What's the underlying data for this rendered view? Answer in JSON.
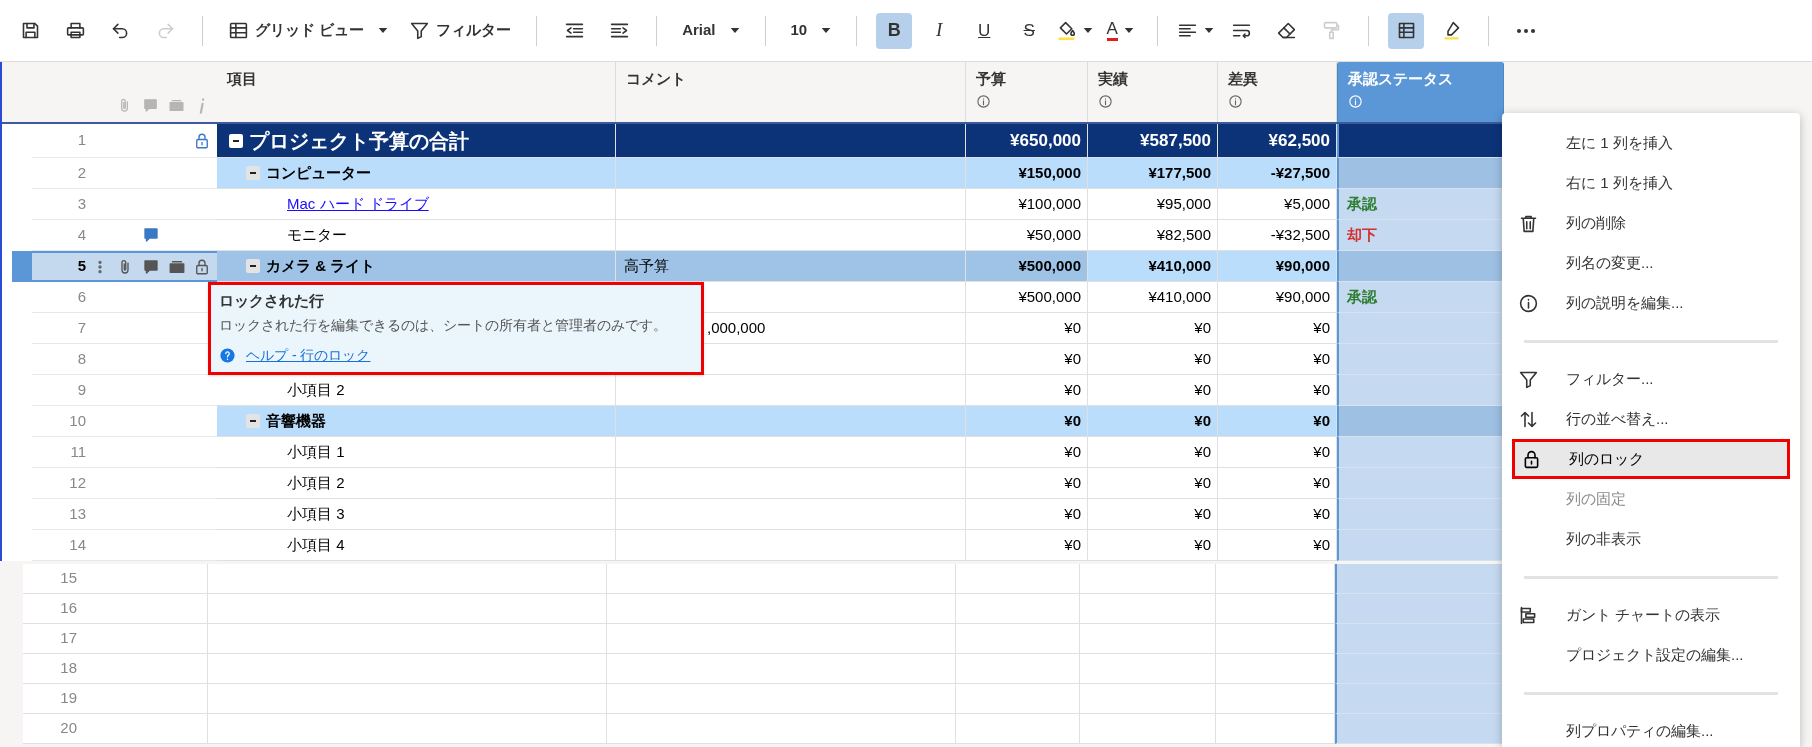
{
  "toolbar": {
    "items": [
      {
        "kind": "icon",
        "active": false,
        "disabled": false
      },
      {
        "kind": "icon",
        "active": false,
        "disabled": false
      },
      {
        "kind": "icon",
        "active": false,
        "disabled": false
      },
      {
        "kind": "icon",
        "active": false,
        "disabled": true
      },
      {
        "kind": "separator"
      },
      {
        "kind": "menu",
        "label": "グリッド ビュー",
        "caret": true
      },
      {
        "kind": "menu",
        "label": "フィルター"
      },
      {
        "kind": "separator"
      },
      {
        "kind": "icon",
        "active": false,
        "disabled": false
      },
      {
        "kind": "icon",
        "active": false,
        "disabled": false
      },
      {
        "kind": "separator"
      },
      {
        "kind": "menu",
        "label": "Arial",
        "caret": true
      },
      {
        "kind": "separator"
      },
      {
        "kind": "menu",
        "label": "10",
        "caret": true
      },
      {
        "kind": "separator"
      },
      {
        "kind": "letter",
        "label": "B",
        "active": true,
        "disabled": false
      },
      {
        "kind": "letter",
        "label": "I",
        "active": false,
        "disabled": false
      },
      {
        "kind": "letter",
        "label": "U",
        "active": false,
        "disabled": false
      },
      {
        "kind": "letter",
        "label": "S",
        "active": false,
        "disabled": false
      },
      {
        "kind": "icon",
        "active": false,
        "disabled": false,
        "caret": true
      },
      {
        "kind": "letter",
        "label": "A",
        "active": false,
        "disabled": false,
        "caret": true
      },
      {
        "kind": "separator"
      },
      {
        "kind": "icon",
        "active": false,
        "disabled": false,
        "caret": true
      },
      {
        "kind": "icon",
        "active": false,
        "disabled": false
      },
      {
        "kind": "icon",
        "active": false,
        "disabled": false
      },
      {
        "kind": "icon",
        "active": false,
        "disabled": true
      },
      {
        "kind": "separator"
      },
      {
        "kind": "icon",
        "active": true,
        "disabled": false
      },
      {
        "kind": "icon",
        "active": false,
        "disabled": false
      },
      {
        "kind": "separator"
      },
      {
        "kind": "icon",
        "active": false,
        "disabled": false
      }
    ]
  },
  "table": {
    "columns": [
      {
        "label": "項目",
        "info": false,
        "selected": false
      },
      {
        "label": "コメント",
        "info": false,
        "selected": false
      },
      {
        "label": "予算",
        "info": true,
        "selected": false
      },
      {
        "label": "実績",
        "info": true,
        "selected": false
      },
      {
        "label": "差異",
        "info": true,
        "selected": false
      },
      {
        "label": "承認ステータス",
        "info": true,
        "selected": true
      }
    ],
    "rows": [
      {
        "number": "1",
        "kind": "total",
        "expanded": true,
        "locked": true,
        "comments": false,
        "selected": false,
        "item": "プロジェクト予算の合計",
        "budget": "¥650,000",
        "actual": "¥587,500",
        "variance": "¥62,500",
        "children": [
          {
            "number": "2",
            "kind": "group",
            "expanded": true,
            "locked": false,
            "comments": false,
            "selected": false,
            "item": "コンピューター",
            "budget": "¥150,000",
            "actual": "¥177,500",
            "variance": "-¥27,500",
            "children": [
              {
                "number": "3",
                "kind": "item",
                "locked": false,
                "comments": false,
                "selected": false,
                "link": true,
                "item": "Mac ハード ドライブ",
                "budget": "¥100,000",
                "actual": "¥95,000",
                "variance": "¥5,000",
                "status": "承認",
                "color": "#2e7d32"
              },
              {
                "number": "4",
                "kind": "item",
                "locked": false,
                "comments": true,
                "selected": false,
                "item": "モニター",
                "budget": "¥50,000",
                "actual": "¥82,500",
                "variance": "-¥32,500",
                "status": "却下",
                "color": "#d32f2f"
              }
            ]
          },
          {
            "number": "5",
            "kind": "group",
            "expanded": true,
            "locked": true,
            "comments": false,
            "selected": true,
            "item": "カメラ & ライト",
            "comment": "高予算",
            "budget": "¥500,000",
            "actual": "¥410,000",
            "variance": "¥90,000",
            "children": [
              {
                "number": "6",
                "kind": "item",
                "locked": false,
                "comments": false,
                "selected": false,
                "budget": "¥500,000",
                "actual": "¥410,000",
                "variance": "¥90,000",
                "status": "承認",
                "color": "#2e7d32"
              },
              {
                "number": "7",
                "kind": "item",
                "locked": false,
                "comments": false,
                "selected": false,
                "comment": ",000,000",
                "comment_covered": true,
                "budget": "¥0",
                "actual": "¥0",
                "variance": "¥0"
              },
              {
                "number": "8",
                "kind": "item",
                "locked": false,
                "comments": false,
                "selected": false,
                "budget": "¥0",
                "actual": "¥0",
                "variance": "¥0"
              },
              {
                "number": "9",
                "kind": "item",
                "locked": false,
                "comments": false,
                "selected": false,
                "item": "小項目 2",
                "budget": "¥0",
                "actual": "¥0",
                "variance": "¥0"
              }
            ]
          },
          {
            "number": "10",
            "kind": "group",
            "expanded": true,
            "locked": false,
            "comments": false,
            "selected": false,
            "item": "音響機器",
            "budget": "¥0",
            "actual": "¥0",
            "variance": "¥0",
            "children": [
              {
                "number": "11",
                "kind": "item",
                "locked": false,
                "comments": false,
                "selected": false,
                "item": "小項目 1",
                "budget": "¥0",
                "actual": "¥0",
                "variance": "¥0"
              },
              {
                "number": "12",
                "kind": "item",
                "locked": false,
                "comments": false,
                "selected": false,
                "item": "小項目 2",
                "budget": "¥0",
                "actual": "¥0",
                "variance": "¥0"
              },
              {
                "number": "13",
                "kind": "item",
                "locked": false,
                "comments": false,
                "selected": false,
                "item": "小項目 3",
                "budget": "¥0",
                "actual": "¥0",
                "variance": "¥0"
              },
              {
                "number": "14",
                "kind": "item",
                "locked": false,
                "comments": false,
                "selected": false,
                "item": "小項目 4",
                "budget": "¥0",
                "actual": "¥0",
                "variance": "¥0"
              }
            ]
          }
        ]
      }
    ],
    "blank_rows": [
      "15",
      "16",
      "17",
      "18",
      "19",
      "20"
    ]
  },
  "tooltip": {
    "title": "ロックされた行",
    "text": "ロックされた行を編集できるのは、シートの所有者と管理者のみです。",
    "link": "ヘルプ - 行のロック",
    "highlighted": true
  },
  "context_menu": {
    "items": [
      {
        "kind": "item",
        "label": "左に 1 列を挿入",
        "disabled": false,
        "highlighted": false
      },
      {
        "kind": "item",
        "label": "右に 1 列を挿入",
        "disabled": false,
        "highlighted": false
      },
      {
        "kind": "item",
        "label": "列の削除",
        "disabled": false,
        "highlighted": false
      },
      {
        "kind": "item",
        "label": "列名の変更...",
        "disabled": false,
        "highlighted": false
      },
      {
        "kind": "item",
        "label": "列の説明を編集...",
        "disabled": false,
        "highlighted": false
      },
      {
        "kind": "separator"
      },
      {
        "kind": "item",
        "label": "フィルター...",
        "disabled": false,
        "highlighted": false
      },
      {
        "kind": "item",
        "label": "行の並べ替え...",
        "disabled": false,
        "highlighted": false
      },
      {
        "kind": "item",
        "label": "列のロック",
        "disabled": false,
        "highlighted": true
      },
      {
        "kind": "item",
        "label": "列の固定",
        "disabled": true,
        "highlighted": false
      },
      {
        "kind": "item",
        "label": "列の非表示",
        "disabled": false,
        "highlighted": false
      },
      {
        "kind": "separator"
      },
      {
        "kind": "item",
        "label": "ガント チャートの表示",
        "disabled": false,
        "highlighted": false
      },
      {
        "kind": "item",
        "label": "プロジェクト設定の編集...",
        "disabled": false,
        "highlighted": false
      },
      {
        "kind": "separator"
      },
      {
        "kind": "item",
        "label": "列プロパティの編集...",
        "disabled": false,
        "highlighted": false
      }
    ]
  }
}
